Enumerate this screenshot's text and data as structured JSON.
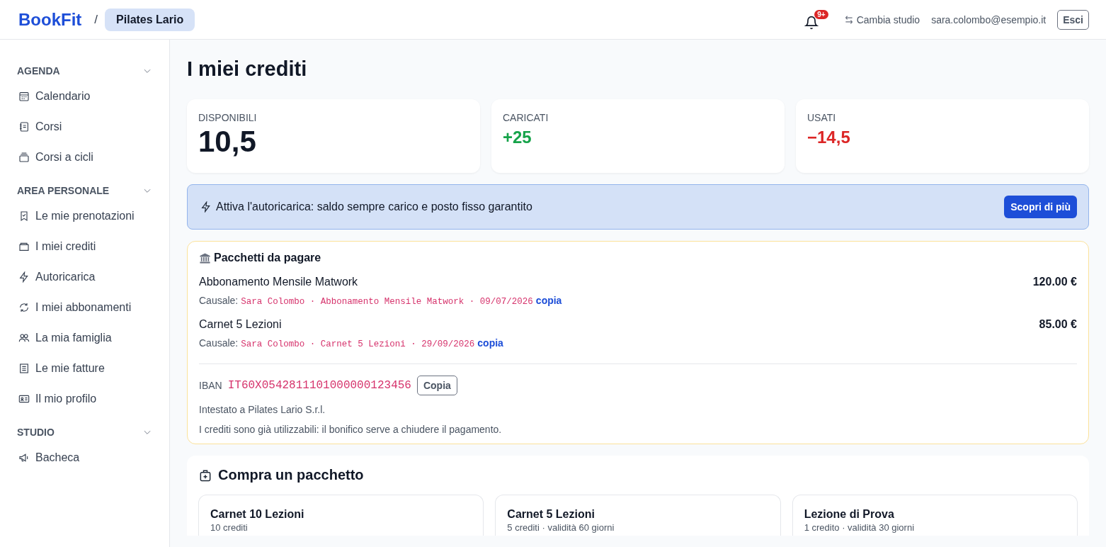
{
  "header": {
    "logo": "BookFit",
    "separator": "/",
    "studio": "Pilates Lario",
    "notifications_badge": "9+",
    "switch_studio": "Cambia studio",
    "email": "sara.colombo@esempio.it",
    "logout": "Esci"
  },
  "sidebar": {
    "sections": [
      {
        "title": "AGENDA",
        "expanded": true,
        "items": [
          {
            "label": "Calendario",
            "kind": "calendar"
          },
          {
            "label": "Corsi",
            "kind": "notebook"
          },
          {
            "label": "Corsi a cicli",
            "kind": "stack"
          }
        ]
      },
      {
        "title": "AREA PERSONALE",
        "expanded": true,
        "items": [
          {
            "label": "Le mie prenotazioni",
            "kind": "bookmark"
          },
          {
            "label": "I miei crediti",
            "kind": "wallet"
          },
          {
            "label": "Autoricarica",
            "kind": "bolt"
          },
          {
            "label": "I miei abbonamenti",
            "kind": "refresh"
          },
          {
            "label": "La mia famiglia",
            "kind": "people"
          },
          {
            "label": "Le mie fatture",
            "kind": "invoice"
          },
          {
            "label": "Il mio profilo",
            "kind": "idcard"
          }
        ]
      },
      {
        "title": "STUDIO",
        "expanded": true,
        "items": [
          {
            "label": "Bacheca",
            "kind": "megaphone"
          }
        ]
      }
    ]
  },
  "page_title": "I miei crediti",
  "stats": [
    {
      "label": "DISPONIBILI",
      "value": "10,5",
      "kind": "neutral"
    },
    {
      "label": "CARICATI",
      "value": "+25",
      "kind": "positive"
    },
    {
      "label": "USATI",
      "value": "−14,5",
      "kind": "negative"
    }
  ],
  "banner": {
    "text": "Attiva l'autoricarica: saldo sempre carico e posto fisso garantito",
    "button": "Scopri di più"
  },
  "pending": {
    "title": "Pacchetti da pagare",
    "items": [
      {
        "name": "Abbonamento Mensile Matwork",
        "price": "120.00 €",
        "reason_label": "Causale:",
        "reason": "Sara Colombo · Abbonamento Mensile Matwork · 09/07/2026",
        "copy": "copia"
      },
      {
        "name": "Carnet 5 Lezioni",
        "price": "85.00 €",
        "reason_label": "Causale:",
        "reason": "Sara Colombo · Carnet 5 Lezioni · 29/09/2026",
        "copy": "copia"
      }
    ],
    "iban_label": "IBAN",
    "iban": "IT60X0542811101000000123456",
    "iban_copy": "Copia",
    "holder": "Intestato a Pilates Lario S.r.l.",
    "note": "I crediti sono già utilizzabili: il bonifico serve a chiudere il pagamento."
  },
  "buy": {
    "title": "Compra un pacchetto",
    "packages": [
      {
        "name": "Carnet 10 Lezioni",
        "detail": "10 crediti"
      },
      {
        "name": "Carnet 5 Lezioni",
        "detail": "5 crediti · validità 60 giorni"
      },
      {
        "name": "Lezione di Prova",
        "detail": "1 credito · validità 30 giorni"
      }
    ]
  }
}
